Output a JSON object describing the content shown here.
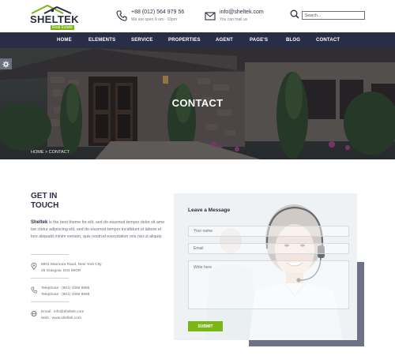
{
  "brand": {
    "name": "SHELTEK",
    "tagline": "Real Estate",
    "accent": "#7cb518",
    "navy": "#2a2d47"
  },
  "header": {
    "phone": {
      "icon": "phone-icon",
      "main": "+88 (012) 564 979 56",
      "sub": "We are open 9 am - 10pm"
    },
    "email": {
      "icon": "envelope-icon",
      "main": "info@sheltek.com",
      "sub": "You can mail us"
    },
    "search": {
      "icon": "search-icon",
      "placeholder": "Search..."
    }
  },
  "nav": {
    "items": [
      "HOME",
      "ELEMENTS",
      "SERVICE",
      "PROPERTIES",
      "AGENT",
      "PAGE'S",
      "BLOG",
      "CONTACT"
    ]
  },
  "hero": {
    "title": "CONTACT",
    "breadcrumb": "HOME > CONTACT",
    "settings_icon": "gear-icon"
  },
  "touch": {
    "title_line1": "GET IN",
    "title_line2": "TOUCH",
    "brand_word": "Sheltek",
    "description": " is the best theme for elit, sed do eiusmod tempor dolor sit ame tse ctetur adipiscing elit, sed do eiusmod tempor incididunt ut labore et lore aliquatd minim veniam, quis nostrud exercitation oris nisi ut aliquip",
    "address": {
      "icon": "location-pin-icon",
      "line1": "8901 Marmora Raod, New York City",
      "line2": "25 Glasgow, D04 89GR"
    },
    "phones": {
      "icon": "phone-icon",
      "line1": "Telephone : (801) 4256 9856",
      "line2": "Telephone : (801) 4256 9658"
    },
    "web": {
      "icon": "globe-icon",
      "line1": "Email : info@sheltek.com",
      "line2": "Web : www.sheltek.com"
    }
  },
  "form": {
    "title": "Leave a Message",
    "name_placeholder": "Your name",
    "email_placeholder": "Email",
    "message_placeholder": "Write here",
    "submit_label": "SUBMIT"
  }
}
